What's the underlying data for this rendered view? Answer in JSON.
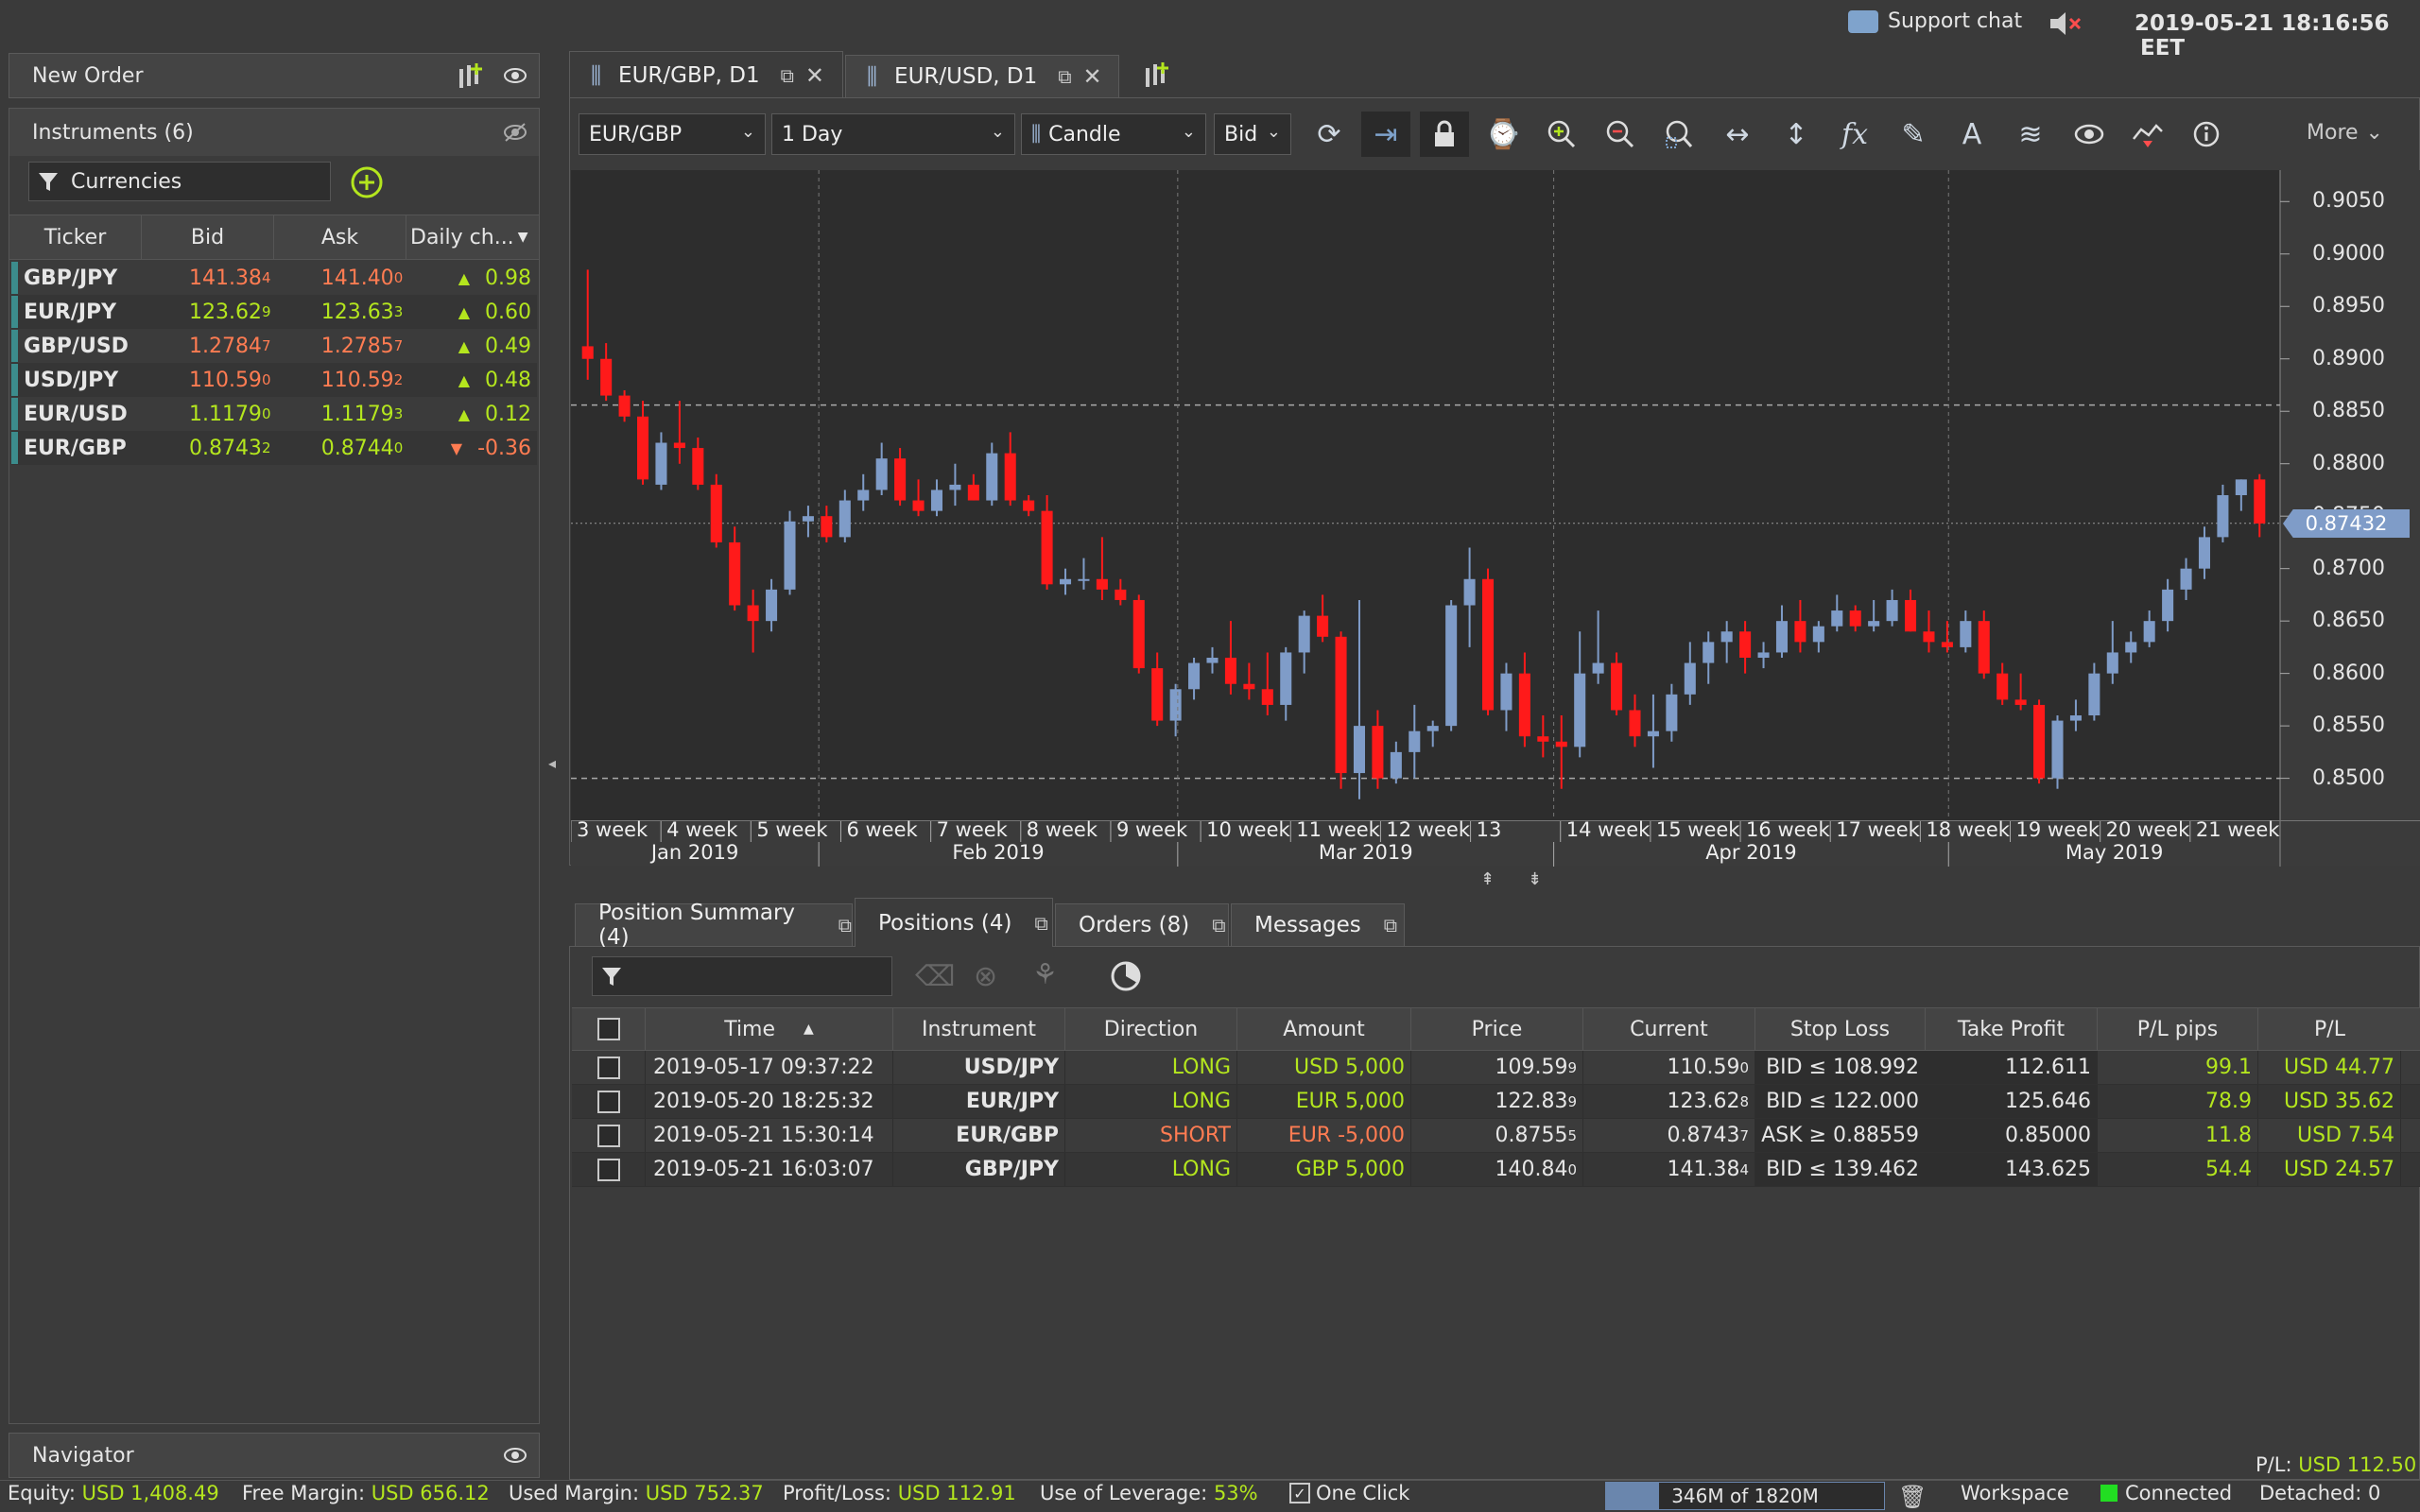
{
  "topbar": {
    "support_chat": "Support chat",
    "datetime": "2019-05-21 18:16:56",
    "timezone": "EET"
  },
  "new_order": {
    "title": "New Order"
  },
  "instruments": {
    "title": "Instruments (6)",
    "filter_label": "Currencies",
    "columns": [
      "Ticker",
      "Bid",
      "Ask",
      "Daily ch..."
    ],
    "rows": [
      {
        "ticker": "GBP/JPY",
        "bid": "141.38",
        "bid_small": "4",
        "ask": "141.40",
        "ask_small": "0",
        "change": "0.98",
        "dir": "up",
        "bid_color": "red"
      },
      {
        "ticker": "EUR/JPY",
        "bid": "123.62",
        "bid_small": "9",
        "ask": "123.63",
        "ask_small": "3",
        "change": "0.60",
        "dir": "up",
        "bid_color": "green"
      },
      {
        "ticker": "GBP/USD",
        "bid": "1.2784",
        "bid_small": "7",
        "ask": "1.2785",
        "ask_small": "7",
        "change": "0.49",
        "dir": "up",
        "bid_color": "red"
      },
      {
        "ticker": "USD/JPY",
        "bid": "110.59",
        "bid_small": "0",
        "ask": "110.59",
        "ask_small": "2",
        "change": "0.48",
        "dir": "up",
        "bid_color": "red"
      },
      {
        "ticker": "EUR/USD",
        "bid": "1.1179",
        "bid_small": "0",
        "ask": "1.1179",
        "ask_small": "3",
        "change": "0.12",
        "dir": "up",
        "bid_color": "green"
      },
      {
        "ticker": "EUR/GBP",
        "bid": "0.8743",
        "bid_small": "2",
        "ask": "0.8744",
        "ask_small": "0",
        "change": "-0.36",
        "dir": "down",
        "bid_color": "green"
      }
    ]
  },
  "navigator": {
    "title": "Navigator"
  },
  "chart_tabs": [
    {
      "label": "EUR/GBP, D1"
    },
    {
      "label": "EUR/USD, D1"
    }
  ],
  "chart_toolbar": {
    "instrument": "EUR/GBP",
    "period": "1 Day",
    "chart_type": "Candle",
    "side": "Bid",
    "more": "More"
  },
  "chart_data": {
    "type": "candlestick",
    "instrument": "EUR/GBP",
    "period": "D1",
    "y_ticks": [
      "0.9050",
      "0.9000",
      "0.8950",
      "0.8900",
      "0.8850",
      "0.8800",
      "0.8750",
      "0.8700",
      "0.8650",
      "0.8600",
      "0.8550",
      "0.8500"
    ],
    "current_price": "0.87432",
    "week_labels": [
      "3 week",
      "4 week",
      "5 week",
      "6 week",
      "7 week",
      "8 week",
      "9 week",
      "10 week",
      "11 week",
      "12 week",
      "13",
      "14 week",
      "15 week",
      "16 week",
      "17 week",
      "18 week",
      "19 week",
      "20 week",
      "21 week"
    ],
    "month_labels": [
      "Jan 2019",
      "Feb 2019",
      "Mar 2019",
      "Apr 2019",
      "May 2019"
    ],
    "ylim": [
      0.846,
      0.908
    ],
    "candles": [
      [
        0.8912,
        0.8985,
        0.888,
        0.89
      ],
      [
        0.89,
        0.8915,
        0.886,
        0.8865
      ],
      [
        0.8865,
        0.887,
        0.884,
        0.8845
      ],
      [
        0.8845,
        0.886,
        0.878,
        0.8785
      ],
      [
        0.878,
        0.883,
        0.8775,
        0.882
      ],
      [
        0.882,
        0.886,
        0.88,
        0.8815
      ],
      [
        0.8815,
        0.8825,
        0.8775,
        0.878
      ],
      [
        0.878,
        0.879,
        0.872,
        0.8725
      ],
      [
        0.8725,
        0.874,
        0.866,
        0.8665
      ],
      [
        0.8665,
        0.868,
        0.862,
        0.865
      ],
      [
        0.865,
        0.869,
        0.864,
        0.868
      ],
      [
        0.868,
        0.8755,
        0.8675,
        0.8745
      ],
      [
        0.8745,
        0.876,
        0.873,
        0.875
      ],
      [
        0.875,
        0.876,
        0.8725,
        0.873
      ],
      [
        0.873,
        0.8775,
        0.8725,
        0.8765
      ],
      [
        0.8765,
        0.879,
        0.8755,
        0.8775
      ],
      [
        0.8775,
        0.882,
        0.877,
        0.8805
      ],
      [
        0.8805,
        0.8815,
        0.876,
        0.8765
      ],
      [
        0.8765,
        0.8785,
        0.875,
        0.8755
      ],
      [
        0.8755,
        0.8785,
        0.875,
        0.8775
      ],
      [
        0.8775,
        0.88,
        0.876,
        0.878
      ],
      [
        0.878,
        0.879,
        0.8765,
        0.8765
      ],
      [
        0.8765,
        0.882,
        0.876,
        0.881
      ],
      [
        0.881,
        0.883,
        0.876,
        0.8765
      ],
      [
        0.8765,
        0.877,
        0.875,
        0.8755
      ],
      [
        0.8755,
        0.877,
        0.868,
        0.8685
      ],
      [
        0.8685,
        0.87,
        0.8675,
        0.869
      ],
      [
        0.869,
        0.871,
        0.868,
        0.869
      ],
      [
        0.869,
        0.873,
        0.867,
        0.868
      ],
      [
        0.868,
        0.869,
        0.8665,
        0.867
      ],
      [
        0.867,
        0.8675,
        0.86,
        0.8605
      ],
      [
        0.8605,
        0.862,
        0.855,
        0.8555
      ],
      [
        0.8555,
        0.859,
        0.854,
        0.8585
      ],
      [
        0.8585,
        0.8615,
        0.8575,
        0.861
      ],
      [
        0.861,
        0.8625,
        0.86,
        0.8615
      ],
      [
        0.8615,
        0.865,
        0.858,
        0.859
      ],
      [
        0.859,
        0.861,
        0.8575,
        0.8585
      ],
      [
        0.8585,
        0.862,
        0.856,
        0.857
      ],
      [
        0.857,
        0.8625,
        0.8555,
        0.862
      ],
      [
        0.862,
        0.866,
        0.86,
        0.8655
      ],
      [
        0.8655,
        0.8675,
        0.863,
        0.8635
      ],
      [
        0.8635,
        0.864,
        0.849,
        0.8505
      ],
      [
        0.8505,
        0.867,
        0.848,
        0.855
      ],
      [
        0.855,
        0.8565,
        0.849,
        0.85
      ],
      [
        0.85,
        0.8535,
        0.8495,
        0.8525
      ],
      [
        0.8525,
        0.857,
        0.85,
        0.8545
      ],
      [
        0.8545,
        0.8555,
        0.853,
        0.855
      ],
      [
        0.855,
        0.867,
        0.8545,
        0.8665
      ],
      [
        0.8665,
        0.872,
        0.8625,
        0.869
      ],
      [
        0.869,
        0.87,
        0.856,
        0.8565
      ],
      [
        0.8565,
        0.861,
        0.8545,
        0.86
      ],
      [
        0.86,
        0.862,
        0.853,
        0.854
      ],
      [
        0.854,
        0.856,
        0.852,
        0.8535
      ],
      [
        0.8535,
        0.856,
        0.849,
        0.853
      ],
      [
        0.853,
        0.864,
        0.852,
        0.86
      ],
      [
        0.86,
        0.866,
        0.859,
        0.861
      ],
      [
        0.861,
        0.862,
        0.856,
        0.8565
      ],
      [
        0.8565,
        0.858,
        0.853,
        0.854
      ],
      [
        0.854,
        0.858,
        0.851,
        0.8545
      ],
      [
        0.8545,
        0.859,
        0.8535,
        0.858
      ],
      [
        0.858,
        0.863,
        0.857,
        0.861
      ],
      [
        0.861,
        0.864,
        0.859,
        0.863
      ],
      [
        0.863,
        0.865,
        0.861,
        0.864
      ],
      [
        0.864,
        0.865,
        0.86,
        0.8615
      ],
      [
        0.8615,
        0.863,
        0.8605,
        0.862
      ],
      [
        0.862,
        0.8665,
        0.8615,
        0.865
      ],
      [
        0.865,
        0.867,
        0.862,
        0.863
      ],
      [
        0.863,
        0.865,
        0.862,
        0.8645
      ],
      [
        0.8645,
        0.8675,
        0.864,
        0.866
      ],
      [
        0.866,
        0.8665,
        0.864,
        0.8645
      ],
      [
        0.8645,
        0.867,
        0.864,
        0.865
      ],
      [
        0.865,
        0.868,
        0.8645,
        0.867
      ],
      [
        0.867,
        0.868,
        0.864,
        0.864
      ],
      [
        0.864,
        0.866,
        0.862,
        0.863
      ],
      [
        0.863,
        0.865,
        0.862,
        0.8625
      ],
      [
        0.8625,
        0.866,
        0.862,
        0.865
      ],
      [
        0.865,
        0.866,
        0.8595,
        0.86
      ],
      [
        0.86,
        0.861,
        0.857,
        0.8575
      ],
      [
        0.8575,
        0.86,
        0.8565,
        0.857
      ],
      [
        0.857,
        0.8575,
        0.8495,
        0.85
      ],
      [
        0.85,
        0.856,
        0.849,
        0.8555
      ],
      [
        0.8555,
        0.8575,
        0.8545,
        0.856
      ],
      [
        0.856,
        0.861,
        0.8555,
        0.86
      ],
      [
        0.86,
        0.865,
        0.859,
        0.862
      ],
      [
        0.862,
        0.864,
        0.861,
        0.863
      ],
      [
        0.863,
        0.866,
        0.8625,
        0.865
      ],
      [
        0.865,
        0.869,
        0.864,
        0.868
      ],
      [
        0.868,
        0.871,
        0.867,
        0.87
      ],
      [
        0.87,
        0.874,
        0.869,
        0.873
      ],
      [
        0.873,
        0.878,
        0.8725,
        0.877
      ],
      [
        0.877,
        0.8785,
        0.8755,
        0.8785
      ],
      [
        0.8785,
        0.879,
        0.873,
        0.8743
      ]
    ]
  },
  "bottom_tabs": [
    {
      "label": "Position Summary (4)"
    },
    {
      "label": "Positions (4)"
    },
    {
      "label": "Orders (8)"
    },
    {
      "label": "Messages"
    }
  ],
  "positions": {
    "columns": [
      "Time",
      "Instrument",
      "Direction",
      "Amount",
      "Price",
      "Current",
      "Stop Loss",
      "Take Profit",
      "P/L pips",
      "P/L"
    ],
    "rows": [
      {
        "time": "2019-05-17 09:37:22",
        "instrument": "USD/JPY",
        "direction": "LONG",
        "amount": "USD 5,000",
        "price": "109.59",
        "price_small": "9",
        "current": "110.59",
        "current_small": "0",
        "stop_loss": "BID ≤ 108.992",
        "take_profit": "112.611",
        "pl_pips": "99.1",
        "pl": "USD 44.77",
        "dir_color": "green"
      },
      {
        "time": "2019-05-20 18:25:32",
        "instrument": "EUR/JPY",
        "direction": "LONG",
        "amount": "EUR 5,000",
        "price": "122.83",
        "price_small": "9",
        "current": "123.62",
        "current_small": "8",
        "stop_loss": "BID ≤ 122.000",
        "take_profit": "125.646",
        "pl_pips": "78.9",
        "pl": "USD 35.62",
        "dir_color": "green"
      },
      {
        "time": "2019-05-21 15:30:14",
        "instrument": "EUR/GBP",
        "direction": "SHORT",
        "amount": "EUR -5,000",
        "price": "0.8755",
        "price_small": "5",
        "current": "0.8743",
        "current_small": "7",
        "stop_loss": "ASK ≥ 0.88559",
        "take_profit": "0.85000",
        "pl_pips": "11.8",
        "pl": "USD 7.54",
        "dir_color": "red"
      },
      {
        "time": "2019-05-21 16:03:07",
        "instrument": "GBP/JPY",
        "direction": "LONG",
        "amount": "GBP 5,000",
        "price": "140.84",
        "price_small": "0",
        "current": "141.38",
        "current_small": "4",
        "stop_loss": "BID ≤ 139.462",
        "take_profit": "143.625",
        "pl_pips": "54.4",
        "pl": "USD 24.57",
        "dir_color": "green"
      }
    ],
    "total_pl_label": "P/L:",
    "total_pl": "USD 112.50"
  },
  "status_bar": {
    "equity_label": "Equity:",
    "equity": "USD 1,408.49",
    "free_margin_label": "Free Margin:",
    "free_margin": "USD 656.12",
    "used_margin_label": "Used Margin:",
    "used_margin": "USD 752.37",
    "pl_label": "Profit/Loss:",
    "pl": "USD 112.91",
    "leverage_label": "Use of Leverage:",
    "leverage": "53%",
    "one_click": "One Click",
    "memory": "346M of 1820M",
    "memory_fraction": 0.19,
    "workspace": "Workspace",
    "connected": "Connected",
    "detached": "Detached: 0"
  },
  "colors": {
    "bull": "#7f9cc8",
    "bear": "#ff1a1a",
    "positive": "#b4e61e",
    "negative": "#ff7c52",
    "accent": "#7fa3cc"
  }
}
